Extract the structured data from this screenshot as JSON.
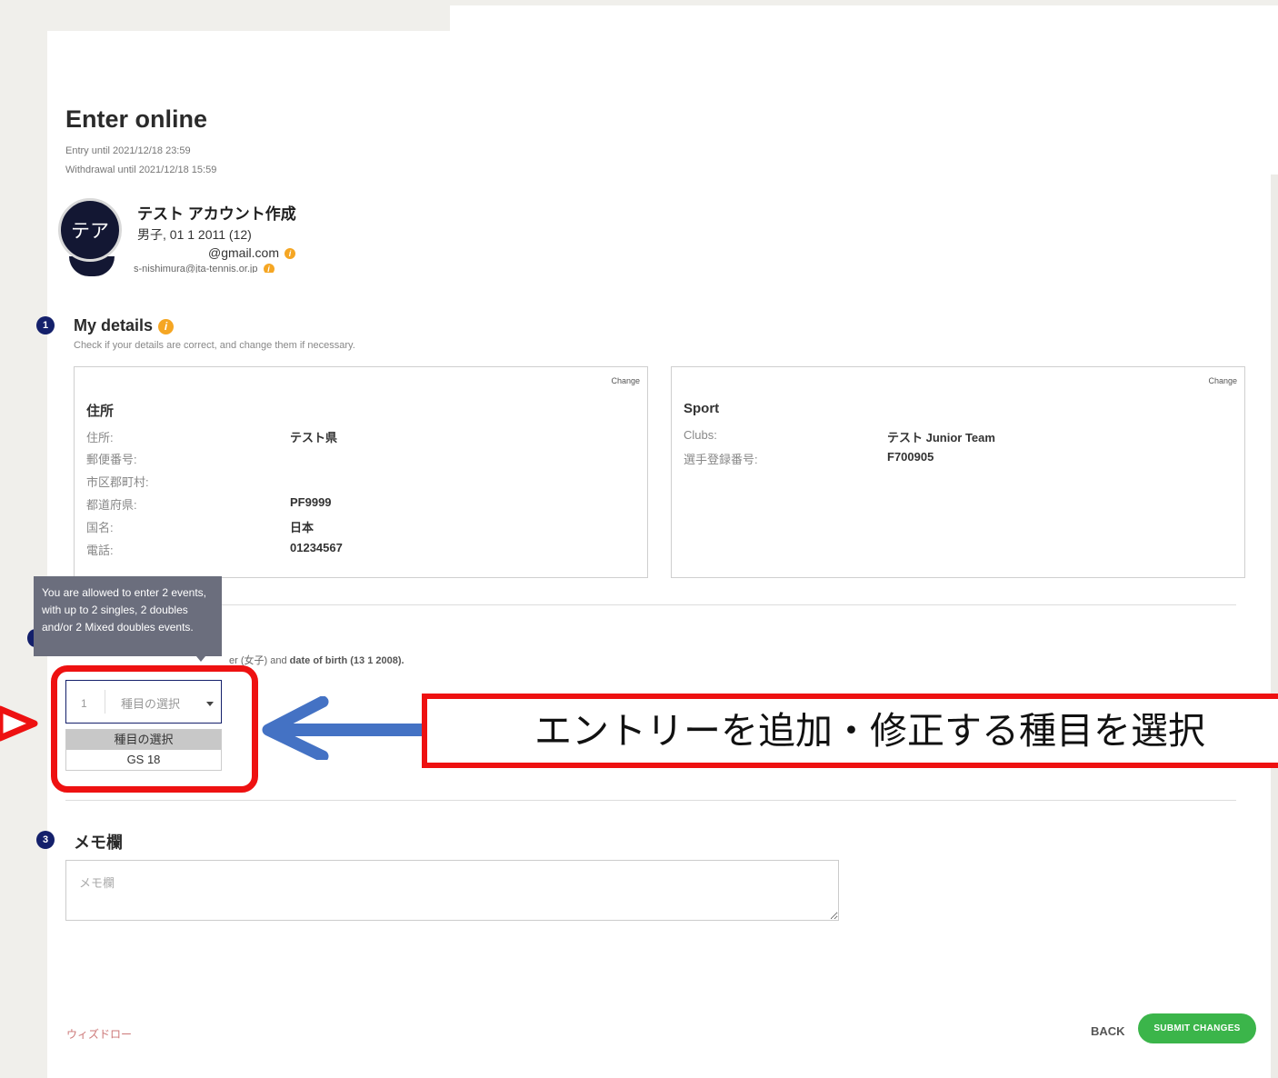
{
  "page": {
    "title": "Enter online",
    "entry_until": "Entry until 2021/12/18 23:59",
    "withdrawal_until": "Withdrawal until 2021/12/18 15:59"
  },
  "profile": {
    "avatar_initials": "テア",
    "name": "テスト アカウント作成",
    "info": "男子, 01 1 2011 (12)",
    "email": "@gmail.com",
    "email2": "s-nishimura@jta-tennis.or.jp"
  },
  "section1": {
    "number": "1",
    "title": "My details",
    "subtitle": "Check if your details are correct, and change them if necessary.",
    "address_card": {
      "change": "Change",
      "title": "住所",
      "rows": [
        {
          "label": "住所:",
          "value": "テスト県"
        },
        {
          "label": "郵便番号:",
          "value": ""
        },
        {
          "label": "市区郡町村:",
          "value": ""
        },
        {
          "label": "都道府県:",
          "value": "PF9999"
        },
        {
          "label": "国名:",
          "value": "日本"
        },
        {
          "label": "電話:",
          "value": "01234567"
        }
      ]
    },
    "sport_card": {
      "change": "Change",
      "title": "Sport",
      "rows": [
        {
          "label": "Clubs:",
          "value": "テスト Junior Team"
        },
        {
          "label": "選手登録番号:",
          "value": "F700905"
        }
      ]
    }
  },
  "section2": {
    "tooltip": "You are allowed to enter 2 events, with up to 2 singles, 2 doubles and/or 2 Mixed doubles events.",
    "sub_prefix": "er (女子)",
    "sub_mid": " and ",
    "sub_bold": "date of birth (13 1 2008).",
    "select": {
      "number": "1",
      "placeholder": "種目の選択",
      "options": [
        "種目の選択",
        "GS 18"
      ]
    }
  },
  "section3": {
    "number": "3",
    "title": "メモ欄",
    "placeholder": "メモ欄"
  },
  "footer": {
    "wizard_link": "ウィズドロー",
    "back": "BACK",
    "submit": "SUBMIT CHANGES"
  },
  "annotation": {
    "label": "エントリーを追加・修正する種目を選択",
    "color": "#ee1111",
    "arrow_color": "#4472c4"
  }
}
